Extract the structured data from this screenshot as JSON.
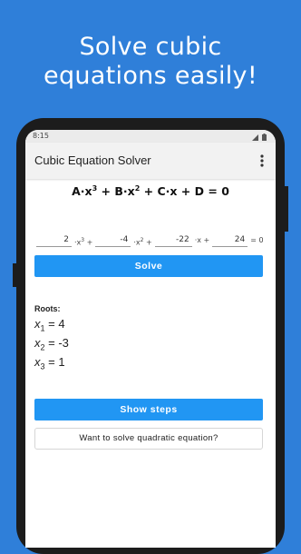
{
  "promo": {
    "line1": "Solve cubic",
    "line2": "equations easily!"
  },
  "status_bar": {
    "time": "8:15",
    "icons": [
      "signal-icon",
      "battery-icon"
    ]
  },
  "app_bar": {
    "title": "Cubic Equation Solver",
    "menu_icon": "more-vert-icon"
  },
  "formula": {
    "part1": "A·x",
    "exp1": "3",
    "part2": " + B·x",
    "exp2": "2",
    "part3": " + C·x + D = 0"
  },
  "inputs": {
    "a": "2",
    "b": "-4",
    "c": "-22",
    "d": "24",
    "term_a": "·x",
    "term_a_exp": "3",
    "term_a_op": " +",
    "term_b": "·x",
    "term_b_exp": "2",
    "term_b_op": " +",
    "term_c": "·x +",
    "term_d": "= 0"
  },
  "solve_button": "Solve",
  "roots": {
    "label": "Roots:",
    "items": [
      {
        "var": "x",
        "sub": "1",
        "value": "= 4"
      },
      {
        "var": "x",
        "sub": "2",
        "value": "= -3"
      },
      {
        "var": "x",
        "sub": "3",
        "value": "= 1"
      }
    ]
  },
  "show_steps_button": "Show steps",
  "quadratic_button": "Want to solve quadratic equation?",
  "colors": {
    "background": "#2f7fd9",
    "accent": "#2196f3"
  }
}
